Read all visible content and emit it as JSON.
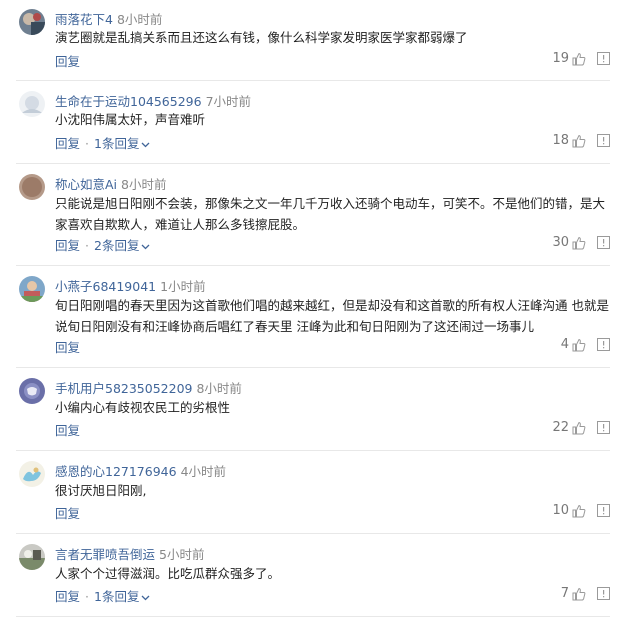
{
  "labels": {
    "reply": "回复",
    "dot": "·"
  },
  "comments": [
    {
      "username": "雨落花下4",
      "time": "8小时前",
      "text": "演艺圈就是乱搞关系而且还这么有钱，像什么科学家发明家医学家都弱爆了",
      "likes": "19",
      "avatar_icon": "user-avatar-icon"
    },
    {
      "username": "生命在于运动104565296",
      "time": "7小时前",
      "text": "小沈阳伟属太奸，声音难听",
      "likes": "18",
      "replies": "1条回复",
      "avatar_icon": "user-avatar-icon"
    },
    {
      "username": "称心如意Ai",
      "time": "8小时前",
      "text": "只能说是旭日阳刚不会装，那像朱之文一年几千万收入还骑个电动车，可笑不。不是他们的错，是大家喜欢自欺欺人，难道让人那么多钱擦屁股。",
      "likes": "30",
      "replies": "2条回复",
      "avatar_icon": "user-avatar-icon"
    },
    {
      "username": "小燕子68419041",
      "time": "1小时前",
      "text": "旬日阳刚唱的春天里因为这首歌他们唱的越来越红，但是却没有和这首歌的所有权人汪峰沟通 也就是说旬日阳刚没有和汪峰协商后唱红了春天里 汪峰为此和旬日阳刚为了这还闹过一场事儿",
      "likes": "4",
      "avatar_icon": "user-avatar-icon"
    },
    {
      "username": "手机用户58235052209",
      "time": "8小时前",
      "text": "小编内心有歧视农民工的劣根性",
      "likes": "22",
      "avatar_icon": "user-avatar-icon"
    },
    {
      "username": "感恩的心127176946",
      "time": "4小时前",
      "text": "很讨厌旭日阳刚,",
      "likes": "10",
      "avatar_icon": "user-avatar-icon"
    },
    {
      "username": "言者无罪喷吾倒运",
      "time": "5小时前",
      "text": "人家个个过得滋润。比吃瓜群众强多了。",
      "likes": "7",
      "replies": "1条回复",
      "avatar_icon": "user-avatar-icon"
    }
  ],
  "colors": {
    "username": "#406599",
    "meta": "#888888",
    "text": "#222222",
    "divider": "#e8e8e8"
  }
}
